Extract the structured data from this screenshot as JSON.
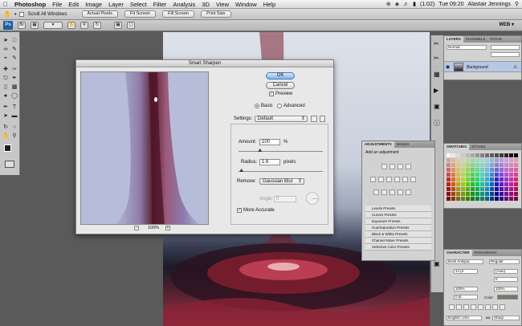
{
  "menubar": {
    "items": [
      "Photoshop",
      "File",
      "Edit",
      "Image",
      "Layer",
      "Select",
      "Filter",
      "Analysis",
      "3D",
      "View",
      "Window",
      "Help"
    ],
    "battery": "(1:02)",
    "clock": "Tue 09:20",
    "user": "Alastair Jennings"
  },
  "options_bar": {
    "scroll_all_windows": "Scroll All Windows",
    "buttons": [
      "Actual Pixels",
      "Fit Screen",
      "Fill Screen",
      "Print Size"
    ]
  },
  "app_bar": {
    "badge": "Ps",
    "workspace": "WEB ▾"
  },
  "dialog": {
    "title": "Smart Sharpen",
    "ok": "OK",
    "cancel": "Cancel",
    "preview": "Preview",
    "mode_basic": "Basic",
    "mode_advanced": "Advanced",
    "settings_label": "Settings:",
    "settings_value": "Default",
    "amount_label": "Amount:",
    "amount_value": "100",
    "amount_unit": "%",
    "amount_fraction": 0.25,
    "radius_label": "Radius:",
    "radius_value": "1.6",
    "radius_unit": "pixels",
    "radius_fraction": 0.03,
    "remove_label": "Remove:",
    "remove_value": "Gaussian Blur",
    "angle_label": "Angle:",
    "angle_value": "0",
    "more_accurate": "More Accurate",
    "zoom": "100%",
    "zoom_minus": "−",
    "zoom_plus": "+"
  },
  "layers_panel": {
    "tabs": [
      "LAYERS",
      "CHANNELS",
      "PATHS"
    ],
    "blend": "Normal",
    "layer_name": "Background"
  },
  "adjustments_panel": {
    "tabs": [
      "ADJUSTMENTS",
      "MASKS"
    ],
    "heading": "Add an adjustment",
    "presets": [
      "Levels Presets",
      "Curves Presets",
      "Exposure Presets",
      "Hue/Saturation Presets",
      "Black & White Presets",
      "Channel Mixer Presets",
      "Selective Color Presets"
    ]
  },
  "swatches_panel": {
    "tabs": [
      "SWATCHES",
      "STYLES"
    ]
  },
  "character_panel": {
    "tabs": [
      "CHARACTER",
      "PARAGRAPH"
    ],
    "font": "Book Antiqua",
    "style": "Regular",
    "size": "14 pt",
    "leading": "(Auto)",
    "tracking": "0",
    "scale_v": "100%",
    "scale_h": "100%",
    "baseline": "0 pt",
    "color_label": "Color:",
    "language": "English: USA",
    "aa_label": "aa",
    "aa": "Sharp"
  }
}
